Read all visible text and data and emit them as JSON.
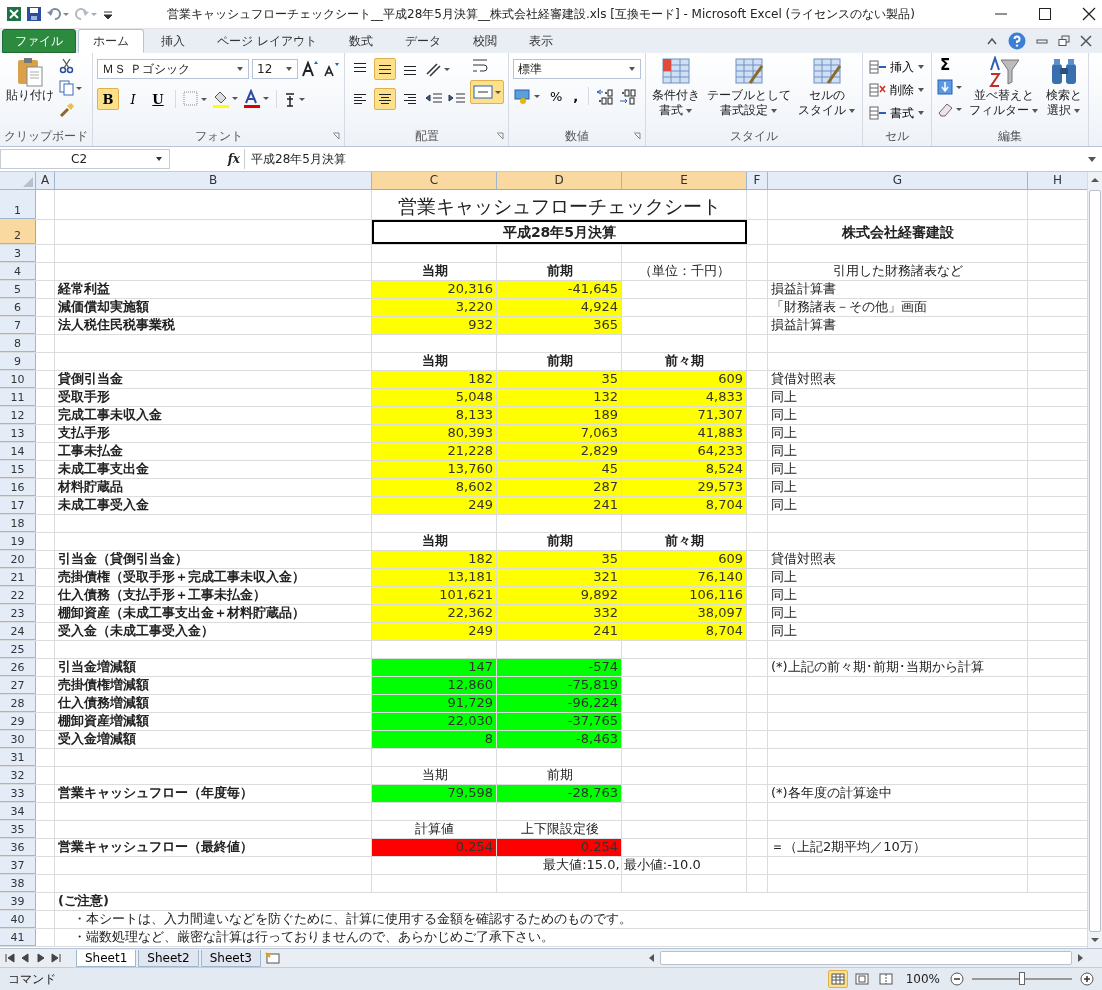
{
  "window": {
    "title": "営業キャッシュフローチェックシート__平成28年5月決算__株式会社経審建設.xls  [互換モード] - Microsoft Excel (ライセンスのない製品)"
  },
  "ribbon_tabs": [
    {
      "label": "ファイル",
      "kind": "file",
      "selected": false
    },
    {
      "label": "ホーム",
      "kind": "tab",
      "selected": true
    },
    {
      "label": "挿入",
      "kind": "tab",
      "selected": false
    },
    {
      "label": "ページ レイアウト",
      "kind": "tab",
      "selected": false
    },
    {
      "label": "数式",
      "kind": "tab",
      "selected": false
    },
    {
      "label": "データ",
      "kind": "tab",
      "selected": false
    },
    {
      "label": "校閲",
      "kind": "tab",
      "selected": false
    },
    {
      "label": "表示",
      "kind": "tab",
      "selected": false
    }
  ],
  "ribbon": {
    "paste": "貼り付け",
    "font_name": "ＭＳ Ｐゴシック",
    "font_size": "12",
    "font_buttons": [
      {
        "label": "B",
        "kind": "bold",
        "selected": true
      },
      {
        "label": "I",
        "kind": "italic",
        "selected": false
      },
      {
        "label": "U",
        "kind": "underline",
        "selected": false
      }
    ],
    "align_buttons": [
      {
        "kind": "top",
        "selected": false
      },
      {
        "kind": "middle",
        "selected": true
      },
      {
        "kind": "bottom",
        "selected": false
      },
      {
        "kind": "left",
        "selected": false
      },
      {
        "kind": "center",
        "selected": true
      },
      {
        "kind": "right",
        "selected": false
      }
    ],
    "merge": {
      "selected": true
    },
    "number_format": "標準",
    "percent": "%",
    "comma": ",",
    "style_buttons": [
      [
        "条件付き",
        "書式"
      ],
      [
        "テーブルとして",
        "書式設定"
      ],
      [
        "セルの",
        "スタイル"
      ]
    ],
    "cell_buttons": [
      "挿入",
      "削除",
      "書式"
    ],
    "sum": "Σ",
    "edit_buttons": [
      [
        "並べ替えと",
        "フィルター"
      ],
      [
        "検索と",
        "選択"
      ]
    ],
    "groups": [
      "クリップボード",
      "フォント",
      "配置",
      "数値",
      "スタイル",
      "セル",
      "編集"
    ]
  },
  "formula_bar": {
    "name_box": "C2",
    "fx": "fx",
    "formula": "平成28年5月決算"
  },
  "sheet": {
    "columns": [
      {
        "label": "A",
        "selected": false
      },
      {
        "label": "B",
        "selected": false
      },
      {
        "label": "C",
        "selected": true
      },
      {
        "label": "D",
        "selected": true
      },
      {
        "label": "E",
        "selected": true
      },
      {
        "label": "F",
        "selected": false
      },
      {
        "label": "G",
        "selected": false
      },
      {
        "label": "H",
        "selected": false
      }
    ],
    "rows": [
      {
        "num": "1",
        "selected": false,
        "cells": [
          "",
          "",
          {
            "kind": "title",
            "text": "営業キャッシュフローチェックシート"
          }
        ]
      },
      {
        "num": "2",
        "selected": true,
        "cells": [
          "",
          "",
          {
            "kind": "box",
            "text": "平成28年5月決算"
          },
          "",
          "",
          "",
          {
            "kind": "heading",
            "text": "株式会社経審建設"
          }
        ]
      },
      {
        "num": "3",
        "selected": false,
        "cells": []
      },
      {
        "num": "4",
        "selected": false,
        "cells": [
          "",
          "",
          {
            "kind": "header",
            "text": "当期"
          },
          {
            "kind": "header",
            "text": "前期"
          },
          {
            "kind": "caption",
            "text": "（単位：千円）"
          },
          "",
          {
            "kind": "caption",
            "text": "引用した財務諸表など"
          }
        ]
      },
      {
        "num": "5",
        "selected": false,
        "cells": [
          "",
          {
            "kind": "label",
            "text": "経常利益"
          },
          {
            "kind": "number",
            "text": "20,316",
            "color": "#ffff00"
          },
          {
            "kind": "number",
            "text": "-41,645",
            "color": "#ffff00"
          },
          "",
          "",
          {
            "kind": "ref",
            "text": "損益計算書"
          }
        ]
      },
      {
        "num": "6",
        "selected": false,
        "cells": [
          "",
          {
            "kind": "label",
            "text": "減価償却実施額"
          },
          {
            "kind": "number",
            "text": "3,220",
            "color": "#ffff00"
          },
          {
            "kind": "number",
            "text": "4,924",
            "color": "#ffff00"
          },
          "",
          "",
          {
            "kind": "ref",
            "text": "「財務諸表－その他」画面"
          }
        ]
      },
      {
        "num": "7",
        "selected": false,
        "cells": [
          "",
          {
            "kind": "label",
            "text": "法人税住民税事業税"
          },
          {
            "kind": "number",
            "text": "932",
            "color": "#ffff00"
          },
          {
            "kind": "number",
            "text": "365",
            "color": "#ffff00"
          },
          "",
          "",
          {
            "kind": "ref",
            "text": "損益計算書"
          }
        ]
      },
      {
        "num": "8",
        "selected": false,
        "cells": []
      },
      {
        "num": "9",
        "selected": false,
        "cells": [
          "",
          "",
          {
            "kind": "header",
            "text": "当期"
          },
          {
            "kind": "header",
            "text": "前期"
          },
          {
            "kind": "header",
            "text": "前々期"
          }
        ]
      },
      {
        "num": "10",
        "selected": false,
        "cells": [
          "",
          {
            "kind": "label",
            "text": "貸倒引当金"
          },
          {
            "kind": "number",
            "text": "182",
            "color": "#ffff00"
          },
          {
            "kind": "number",
            "text": "35",
            "color": "#ffff00"
          },
          {
            "kind": "number",
            "text": "609",
            "color": "#ffff00"
          },
          "",
          {
            "kind": "ref",
            "text": "貸借対照表"
          }
        ]
      },
      {
        "num": "11",
        "selected": false,
        "cells": [
          "",
          {
            "kind": "label",
            "text": "受取手形"
          },
          {
            "kind": "number",
            "text": "5,048",
            "color": "#ffff00"
          },
          {
            "kind": "number",
            "text": "132",
            "color": "#ffff00"
          },
          {
            "kind": "number",
            "text": "4,833",
            "color": "#ffff00"
          },
          "",
          {
            "kind": "ref",
            "text": "同上"
          }
        ]
      },
      {
        "num": "12",
        "selected": false,
        "cells": [
          "",
          {
            "kind": "label",
            "text": "完成工事未収入金"
          },
          {
            "kind": "number",
            "text": "8,133",
            "color": "#ffff00"
          },
          {
            "kind": "number",
            "text": "189",
            "color": "#ffff00"
          },
          {
            "kind": "number",
            "text": "71,307",
            "color": "#ffff00"
          },
          "",
          {
            "kind": "ref",
            "text": "同上"
          }
        ]
      },
      {
        "num": "13",
        "selected": false,
        "cells": [
          "",
          {
            "kind": "label",
            "text": "支払手形"
          },
          {
            "kind": "number",
            "text": "80,393",
            "color": "#ffff00"
          },
          {
            "kind": "number",
            "text": "7,063",
            "color": "#ffff00"
          },
          {
            "kind": "number",
            "text": "41,883",
            "color": "#ffff00"
          },
          "",
          {
            "kind": "ref",
            "text": "同上"
          }
        ]
      },
      {
        "num": "14",
        "selected": false,
        "cells": [
          "",
          {
            "kind": "label",
            "text": "工事未払金"
          },
          {
            "kind": "number",
            "text": "21,228",
            "color": "#ffff00"
          },
          {
            "kind": "number",
            "text": "2,829",
            "color": "#ffff00"
          },
          {
            "kind": "number",
            "text": "64,233",
            "color": "#ffff00"
          },
          "",
          {
            "kind": "ref",
            "text": "同上"
          }
        ]
      },
      {
        "num": "15",
        "selected": false,
        "cells": [
          "",
          {
            "kind": "label",
            "text": "未成工事支出金"
          },
          {
            "kind": "number",
            "text": "13,760",
            "color": "#ffff00"
          },
          {
            "kind": "number",
            "text": "45",
            "color": "#ffff00"
          },
          {
            "kind": "number",
            "text": "8,524",
            "color": "#ffff00"
          },
          "",
          {
            "kind": "ref",
            "text": "同上"
          }
        ]
      },
      {
        "num": "16",
        "selected": false,
        "cells": [
          "",
          {
            "kind": "label",
            "text": "材料貯蔵品"
          },
          {
            "kind": "number",
            "text": "8,602",
            "color": "#ffff00"
          },
          {
            "kind": "number",
            "text": "287",
            "color": "#ffff00"
          },
          {
            "kind": "number",
            "text": "29,573",
            "color": "#ffff00"
          },
          "",
          {
            "kind": "ref",
            "text": "同上"
          }
        ]
      },
      {
        "num": "17",
        "selected": false,
        "cells": [
          "",
          {
            "kind": "label",
            "text": "未成工事受入金"
          },
          {
            "kind": "number",
            "text": "249",
            "color": "#ffff00"
          },
          {
            "kind": "number",
            "text": "241",
            "color": "#ffff00"
          },
          {
            "kind": "number",
            "text": "8,704",
            "color": "#ffff00"
          },
          "",
          {
            "kind": "ref",
            "text": "同上"
          }
        ]
      },
      {
        "num": "18",
        "selected": false,
        "cells": []
      },
      {
        "num": "19",
        "selected": false,
        "cells": [
          "",
          "",
          {
            "kind": "header",
            "text": "当期"
          },
          {
            "kind": "header",
            "text": "前期"
          },
          {
            "kind": "header",
            "text": "前々期"
          }
        ]
      },
      {
        "num": "20",
        "selected": false,
        "cells": [
          "",
          {
            "kind": "label",
            "text": "引当金（貸倒引当金）"
          },
          {
            "kind": "number",
            "text": "182",
            "color": "#ffff00"
          },
          {
            "kind": "number",
            "text": "35",
            "color": "#ffff00"
          },
          {
            "kind": "number",
            "text": "609",
            "color": "#ffff00"
          },
          "",
          {
            "kind": "ref",
            "text": "貸借対照表"
          }
        ]
      },
      {
        "num": "21",
        "selected": false,
        "cells": [
          "",
          {
            "kind": "label",
            "text": "売掛債権（受取手形＋完成工事未収入金）"
          },
          {
            "kind": "number",
            "text": "13,181",
            "color": "#ffff00"
          },
          {
            "kind": "number",
            "text": "321",
            "color": "#ffff00"
          },
          {
            "kind": "number",
            "text": "76,140",
            "color": "#ffff00"
          },
          "",
          {
            "kind": "ref",
            "text": "同上"
          }
        ]
      },
      {
        "num": "22",
        "selected": false,
        "cells": [
          "",
          {
            "kind": "label",
            "text": "仕入債務（支払手形＋工事未払金）"
          },
          {
            "kind": "number",
            "text": "101,621",
            "color": "#ffff00"
          },
          {
            "kind": "number",
            "text": "9,892",
            "color": "#ffff00"
          },
          {
            "kind": "number",
            "text": "106,116",
            "color": "#ffff00"
          },
          "",
          {
            "kind": "ref",
            "text": "同上"
          }
        ]
      },
      {
        "num": "23",
        "selected": false,
        "cells": [
          "",
          {
            "kind": "label",
            "text": "棚卸資産（未成工事支出金＋材料貯蔵品）"
          },
          {
            "kind": "number",
            "text": "22,362",
            "color": "#ffff00"
          },
          {
            "kind": "number",
            "text": "332",
            "color": "#ffff00"
          },
          {
            "kind": "number",
            "text": "38,097",
            "color": "#ffff00"
          },
          "",
          {
            "kind": "ref",
            "text": "同上"
          }
        ]
      },
      {
        "num": "24",
        "selected": false,
        "cells": [
          "",
          {
            "kind": "label",
            "text": "受入金（未成工事受入金）"
          },
          {
            "kind": "number",
            "text": "249",
            "color": "#ffff00"
          },
          {
            "kind": "number",
            "text": "241",
            "color": "#ffff00"
          },
          {
            "kind": "number",
            "text": "8,704",
            "color": "#ffff00"
          },
          "",
          {
            "kind": "ref",
            "text": "同上"
          }
        ]
      },
      {
        "num": "25",
        "selected": false,
        "cells": []
      },
      {
        "num": "26",
        "selected": false,
        "cells": [
          "",
          {
            "kind": "label",
            "text": "引当金増減額"
          },
          {
            "kind": "number",
            "text": "147",
            "color": "#00ff00"
          },
          {
            "kind": "number",
            "text": "-574",
            "color": "#00ff00"
          },
          "",
          "",
          {
            "kind": "ref",
            "text": "(*)上記の前々期･前期･当期から計算"
          }
        ]
      },
      {
        "num": "27",
        "selected": false,
        "cells": [
          "",
          {
            "kind": "label",
            "text": "売掛債権増減額"
          },
          {
            "kind": "number",
            "text": "12,860",
            "color": "#00ff00"
          },
          {
            "kind": "number",
            "text": "-75,819",
            "color": "#00ff00"
          }
        ]
      },
      {
        "num": "28",
        "selected": false,
        "cells": [
          "",
          {
            "kind": "label",
            "text": "仕入債務増減額"
          },
          {
            "kind": "number",
            "text": "91,729",
            "color": "#00ff00"
          },
          {
            "kind": "number",
            "text": "-96,224",
            "color": "#00ff00"
          }
        ]
      },
      {
        "num": "29",
        "selected": false,
        "cells": [
          "",
          {
            "kind": "label",
            "text": "棚卸資産増減額"
          },
          {
            "kind": "number",
            "text": "22,030",
            "color": "#00ff00"
          },
          {
            "kind": "number",
            "text": "-37,765",
            "color": "#00ff00"
          }
        ]
      },
      {
        "num": "30",
        "selected": false,
        "cells": [
          "",
          {
            "kind": "label",
            "text": "受入金増減額"
          },
          {
            "kind": "number",
            "text": "8",
            "color": "#00ff00"
          },
          {
            "kind": "number",
            "text": "-8,463",
            "color": "#00ff00"
          }
        ]
      },
      {
        "num": "31",
        "selected": false,
        "cells": []
      },
      {
        "num": "32",
        "selected": false,
        "cells": [
          "",
          "",
          {
            "kind": "caption",
            "text": "当期"
          },
          {
            "kind": "caption",
            "text": "前期"
          }
        ]
      },
      {
        "num": "33",
        "selected": false,
        "cells": [
          "",
          {
            "kind": "label",
            "text": "営業キャッシュフロー（年度毎）"
          },
          {
            "kind": "number",
            "text": "79,598",
            "color": "#00ff00"
          },
          {
            "kind": "number",
            "text": "-28,763",
            "color": "#00ff00"
          },
          "",
          "",
          {
            "kind": "ref",
            "text": "(*)各年度の計算途中"
          }
        ]
      },
      {
        "num": "34",
        "selected": false,
        "cells": []
      },
      {
        "num": "35",
        "selected": false,
        "cells": [
          "",
          "",
          {
            "kind": "caption",
            "text": "計算値"
          },
          {
            "kind": "caption",
            "text": "上下限設定後"
          }
        ]
      },
      {
        "num": "36",
        "selected": false,
        "cells": [
          "",
          {
            "kind": "label",
            "text": "営業キャッシュフロー（最終値）"
          },
          {
            "kind": "number",
            "text": "0.254",
            "color": "#ff0000"
          },
          {
            "kind": "number",
            "text": "0.254",
            "color": "#ff0000"
          },
          "",
          "",
          {
            "kind": "ref",
            "text": "＝（上記2期平均／10万）"
          }
        ]
      },
      {
        "num": "37",
        "selected": false,
        "cells": [
          "",
          "",
          "",
          {
            "kind": "wide",
            "text": "最大値:15.0, 最小値:-10.0"
          }
        ]
      },
      {
        "num": "38",
        "selected": false,
        "cells": []
      },
      {
        "num": "39",
        "selected": false,
        "cells": [
          "",
          {
            "kind": "notehead",
            "text": "(ご注意)"
          }
        ]
      },
      {
        "num": "40",
        "selected": false,
        "cells": [
          "",
          {
            "kind": "note",
            "text": "・本シートは、入力間違いなどを防ぐために、計算に使用する金額を確認するためのものです。"
          }
        ]
      },
      {
        "num": "41",
        "selected": false,
        "cells": [
          "",
          {
            "kind": "note",
            "text": "・端数処理など、厳密な計算は行っておりませんので、あらかじめご了承下さい。"
          }
        ]
      }
    ]
  },
  "sheet_tabs": [
    {
      "label": "Sheet1",
      "selected": true
    },
    {
      "label": "Sheet2",
      "selected": false
    },
    {
      "label": "Sheet3",
      "selected": false
    }
  ],
  "status_bar": {
    "mode": "コマンド",
    "views": [
      {
        "kind": "normal",
        "selected": true
      },
      {
        "kind": "layout",
        "selected": false
      },
      {
        "kind": "break",
        "selected": false
      }
    ],
    "zoom": "100%",
    "zoom_slider": {
      "level": 0.5
    }
  }
}
